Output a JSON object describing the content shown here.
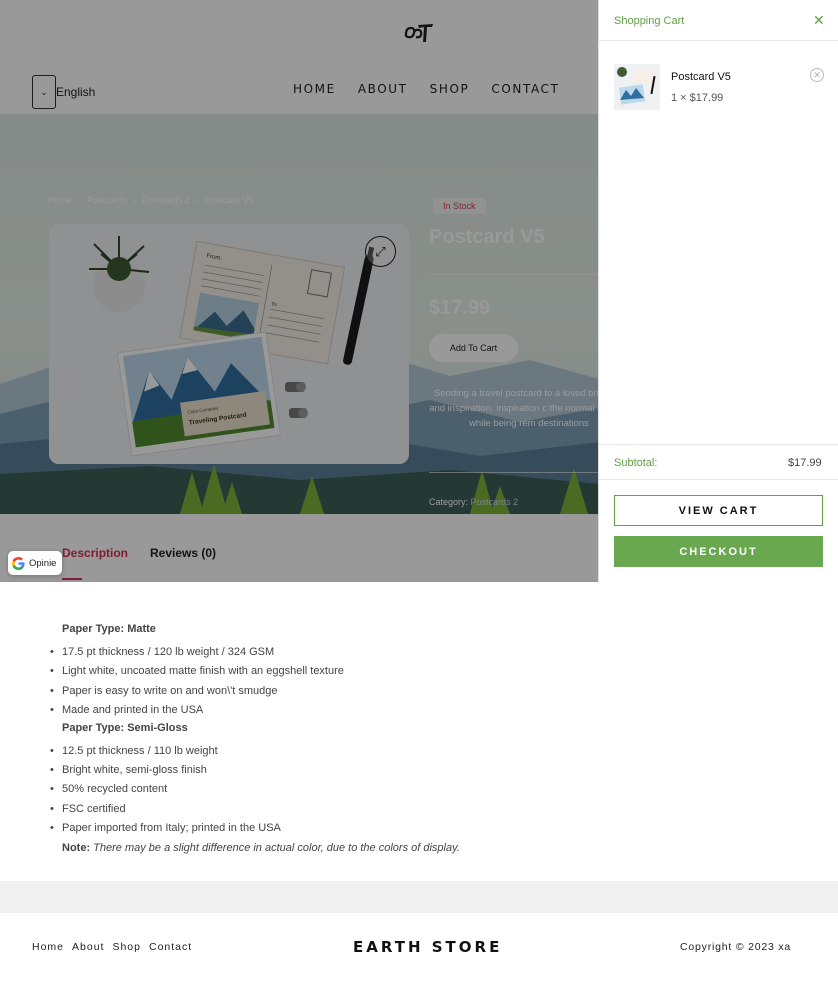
{
  "header": {
    "language": {
      "value": "English",
      "chevron_icon": "chevron-down-icon"
    },
    "nav": [
      "HOME",
      "ABOUT",
      "SHOP",
      "CONTACT"
    ]
  },
  "breadcrumb": [
    "Home",
    "Postcards",
    "Postcards 2",
    "Postcard V5"
  ],
  "product": {
    "stock": "In Stock",
    "title": "Postcard V5",
    "price": "$17.99",
    "add_to_cart": "Add To Cart",
    "description": "Sending a travel postcard to a loved bring joy and inspiration. inspiration c the normal routine, while being rem destinations",
    "category_label": "Category:",
    "category_value": "Postcards 2",
    "image_text_from": "From:",
    "image_text_to": "To:",
    "image_caption_small": "Color Company",
    "image_caption_big": "Traveling Postcard"
  },
  "tabs": {
    "description": "Description",
    "reviews": "Reviews (0)"
  },
  "opinie": "Opinie",
  "content": {
    "matte_heading": "Paper Type: Matte",
    "matte_items": [
      "17.5 pt thickness / 120 lb weight / 324 GSM",
      "Light white, uncoated matte finish with an eggshell texture",
      "Paper is easy to write on and won\\'t smudge",
      "Made and printed in the USA"
    ],
    "semigloss_heading": "Paper Type: Semi-Gloss",
    "semigloss_items": [
      "12.5 pt thickness / 110 lb weight",
      "Bright white, semi-gloss finish",
      "50% recycled content",
      "FSC certified",
      "Paper imported from Italy; printed in the USA"
    ],
    "note_label": "Note:",
    "note_text": "There may be a slight difference in actual color, due to the colors of display."
  },
  "footer": {
    "links": [
      "Home",
      "About",
      "Shop",
      "Contact"
    ],
    "brand": "EARTH STORE",
    "copyright": "Copyright © 2023 xa"
  },
  "cart": {
    "title": "Shopping Cart",
    "item": {
      "name": "Postcard V5",
      "quantity_price": "1 × $17.99"
    },
    "subtotal_label": "Subtotal:",
    "subtotal_value": "$17.99",
    "view_cart": "VIEW CART",
    "checkout": "CHECKOUT"
  },
  "colors": {
    "accent_green": "#6aa84f",
    "accent_pink": "#d6305a"
  }
}
